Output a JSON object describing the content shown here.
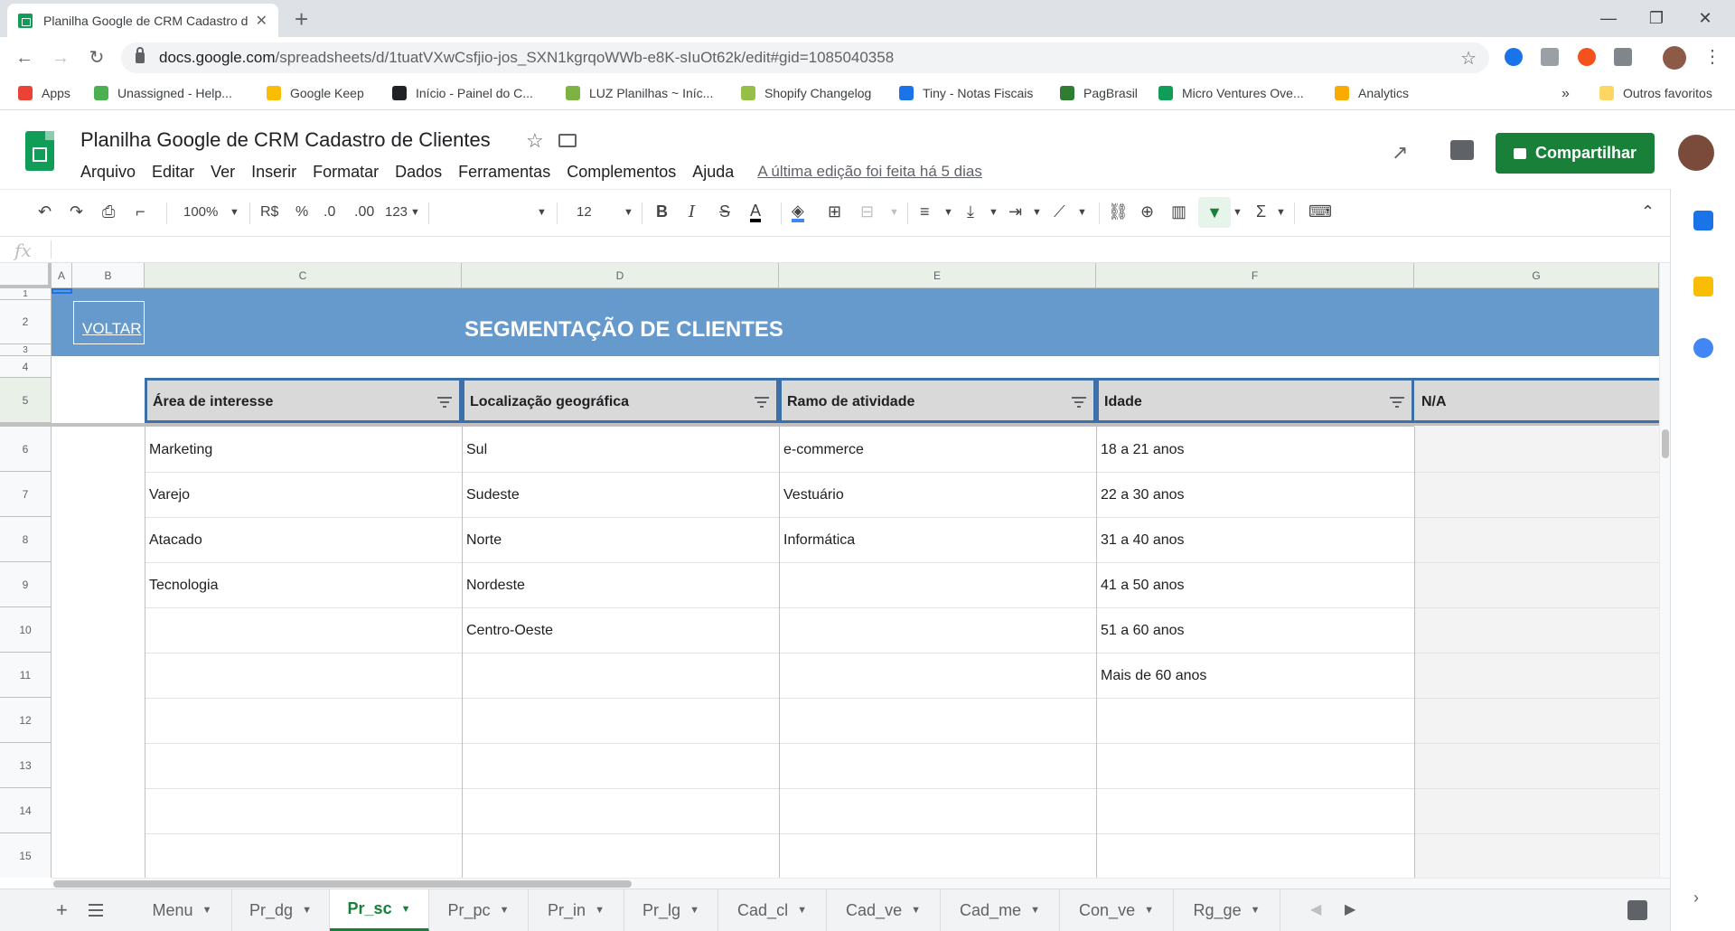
{
  "browser": {
    "tab_title": "Planilha Google de CRM Cadastro de Clientes",
    "new_tab": "+",
    "minimize": "—",
    "restore": "❐",
    "close": "✕",
    "url_host": "docs.google.com",
    "url_path": "/spreadsheets/d/1tuatVXwCsfjio-jos_SXN1kgrqoWWb-e8K-sIuOt62k/edit#gid=1085040358",
    "bookmarks": [
      {
        "label": "Apps",
        "color": "#ea4335"
      },
      {
        "label": "Unassigned - Help...",
        "color": "#4caf50"
      },
      {
        "label": "Google Keep",
        "color": "#fbbc04"
      },
      {
        "label": "Início - Painel do C...",
        "color": "#202124"
      },
      {
        "label": "LUZ Planilhas ~ Iníc...",
        "color": "#7cb342"
      },
      {
        "label": "Shopify Changelog",
        "color": "#95bf47"
      },
      {
        "label": "Tiny - Notas Fiscais",
        "color": "#1a73e8"
      },
      {
        "label": "PagBrasil",
        "color": "#2e7d32"
      },
      {
        "label": "Micro Ventures Ove...",
        "color": "#0f9d58"
      },
      {
        "label": "Analytics",
        "color": "#f9ab00"
      }
    ],
    "overflow": "»",
    "other_bookmarks": "Outros favoritos"
  },
  "sheets": {
    "title": "Planilha  Google de CRM Cadastro de Clientes",
    "menu": [
      "Arquivo",
      "Editar",
      "Ver",
      "Inserir",
      "Formatar",
      "Dados",
      "Ferramentas",
      "Complementos",
      "Ajuda"
    ],
    "last_edit": "A última edição foi feita há 5 dias",
    "share_label": "Compartilhar"
  },
  "toolbar": {
    "zoom": "100%",
    "currency": "R$",
    "percent": "%",
    "decimal_less": ".0",
    "decimal_more": ".00",
    "format_more": "123",
    "font_size": "12",
    "bold": "B",
    "italic": "I",
    "strike": "S",
    "text_color": "A",
    "sigma": "Σ"
  },
  "formula_bar": {
    "fx": "fx"
  },
  "columns": [
    "A",
    "B",
    "C",
    "D",
    "E",
    "F",
    "G"
  ],
  "rows": [
    "1",
    "2",
    "3",
    "4",
    "5",
    "6",
    "7",
    "8",
    "9",
    "10",
    "11",
    "12",
    "13",
    "14",
    "15"
  ],
  "banner": {
    "title": "SEGMENTAÇÃO DE CLIENTES",
    "back_link": "VOLTAR"
  },
  "table": {
    "headers": [
      "Área de interesse",
      "Localização geográfica",
      "Ramo de atividade",
      "Idade",
      "N/A"
    ],
    "col_c": [
      "Marketing",
      "Varejo",
      "Atacado",
      "Tecnologia"
    ],
    "col_d": [
      "Sul",
      "Sudeste",
      "Norte",
      "Nordeste",
      "Centro-Oeste"
    ],
    "col_e": [
      "e-commerce",
      "Vestuário",
      "Informática"
    ],
    "col_f": [
      "18 a 21 anos",
      "22 a 30 anos",
      "31 a 40 anos",
      "41 a 50 anos",
      "51 a 60 anos",
      "Mais de 60 anos"
    ]
  },
  "sheet_tabs": [
    "Menu",
    "Pr_dg",
    "Pr_sc",
    "Pr_pc",
    "Pr_in",
    "Pr_lg",
    "Cad_cl",
    "Cad_ve",
    "Cad_me",
    "Con_ve",
    "Rg_ge"
  ],
  "active_sheet": "Pr_sc"
}
